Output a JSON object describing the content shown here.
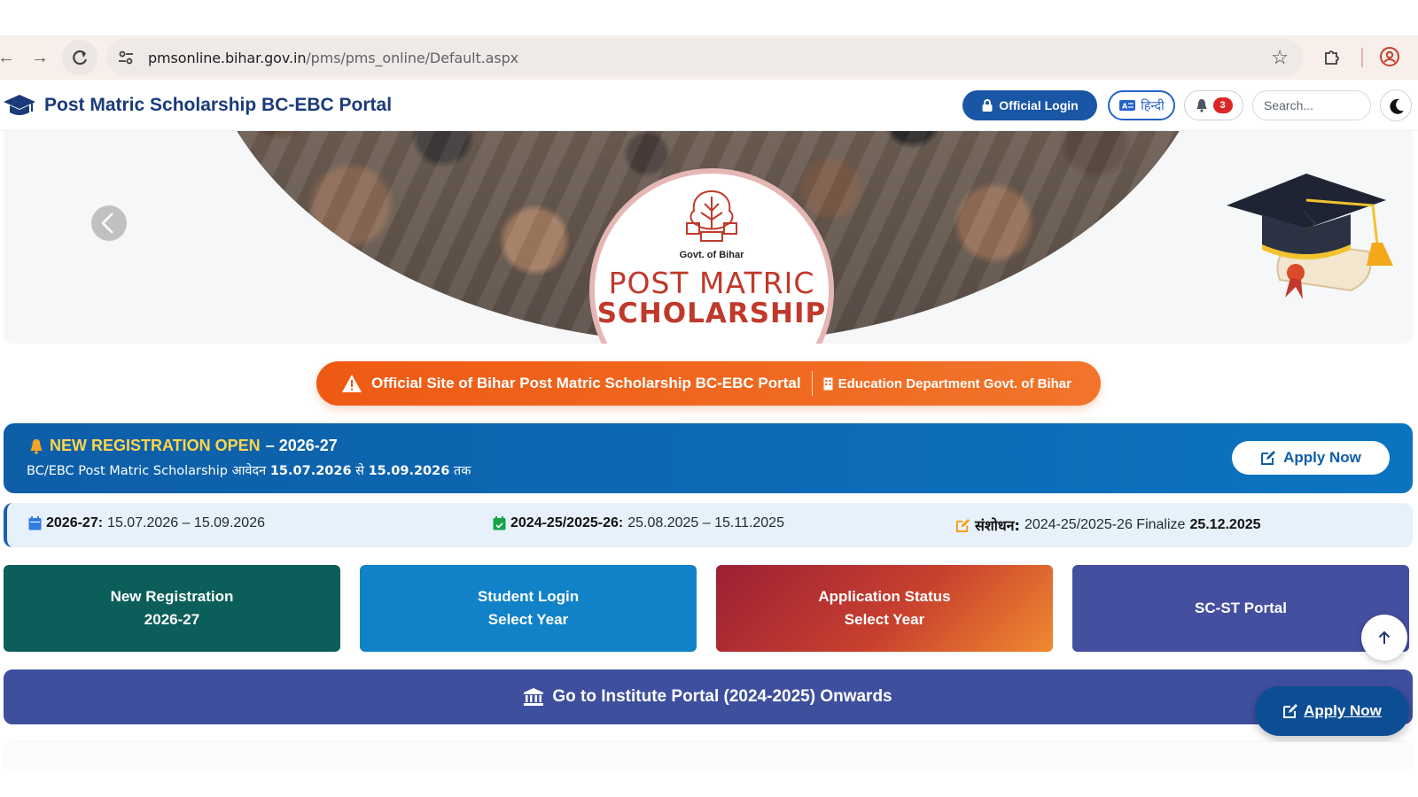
{
  "browser": {
    "url_host": "pmsonline.bihar.gov.in",
    "url_path": "/pms/pms_online/Default.aspx"
  },
  "header": {
    "title": "Post Matric Scholarship BC-EBC Portal",
    "login_label": "Official Login",
    "hindi_label": "हिन्दी",
    "notification_count": "3",
    "search_placeholder": "Search..."
  },
  "hero": {
    "govt_label": "Govt. of Bihar",
    "line1": "POST MATRIC",
    "line2": "SCHOLARSHIP"
  },
  "official_pill": {
    "main": "Official Site of Bihar Post Matric Scholarship BC-EBC Portal",
    "sub": "Education Department Govt. of Bihar"
  },
  "registration": {
    "highlight": "NEW REGISTRATION OPEN",
    "year": " – 2026-27",
    "sub_prefix": "BC/EBC Post Matric Scholarship आवेदन ",
    "start": "15.07.2026",
    "mid": " से ",
    "end": "15.09.2026",
    "suffix": " तक",
    "apply_label": "Apply Now"
  },
  "dates": {
    "d1_label": "2026-27:",
    "d1_value": " 15.07.2026 – 15.09.2026",
    "d2_label": "2024-25/2025-26:",
    "d2_value": " 25.08.2025 – 15.11.2025",
    "d3_label": "संशोधन:",
    "d3_value": " 2024-25/2025-26 Finalize ",
    "d3_date": "25.12.2025"
  },
  "tiles": [
    {
      "line1": "New Registration",
      "line2": "2026-27"
    },
    {
      "line1": "Student Login",
      "line2": "Select Year"
    },
    {
      "line1": "Application Status",
      "line2": "Select Year"
    },
    {
      "line1": "SC-ST Portal"
    }
  ],
  "institute": {
    "label": "Go to Institute Portal (2024-2025) Onwards"
  },
  "float_apply": {
    "label": "Apply Now"
  },
  "colors": {
    "brand_blue": "#1a3a7a",
    "login_blue": "#1a56a6",
    "orange": "#ee5a14",
    "teal": "#0b5e5a",
    "indigo": "#444fa0"
  }
}
